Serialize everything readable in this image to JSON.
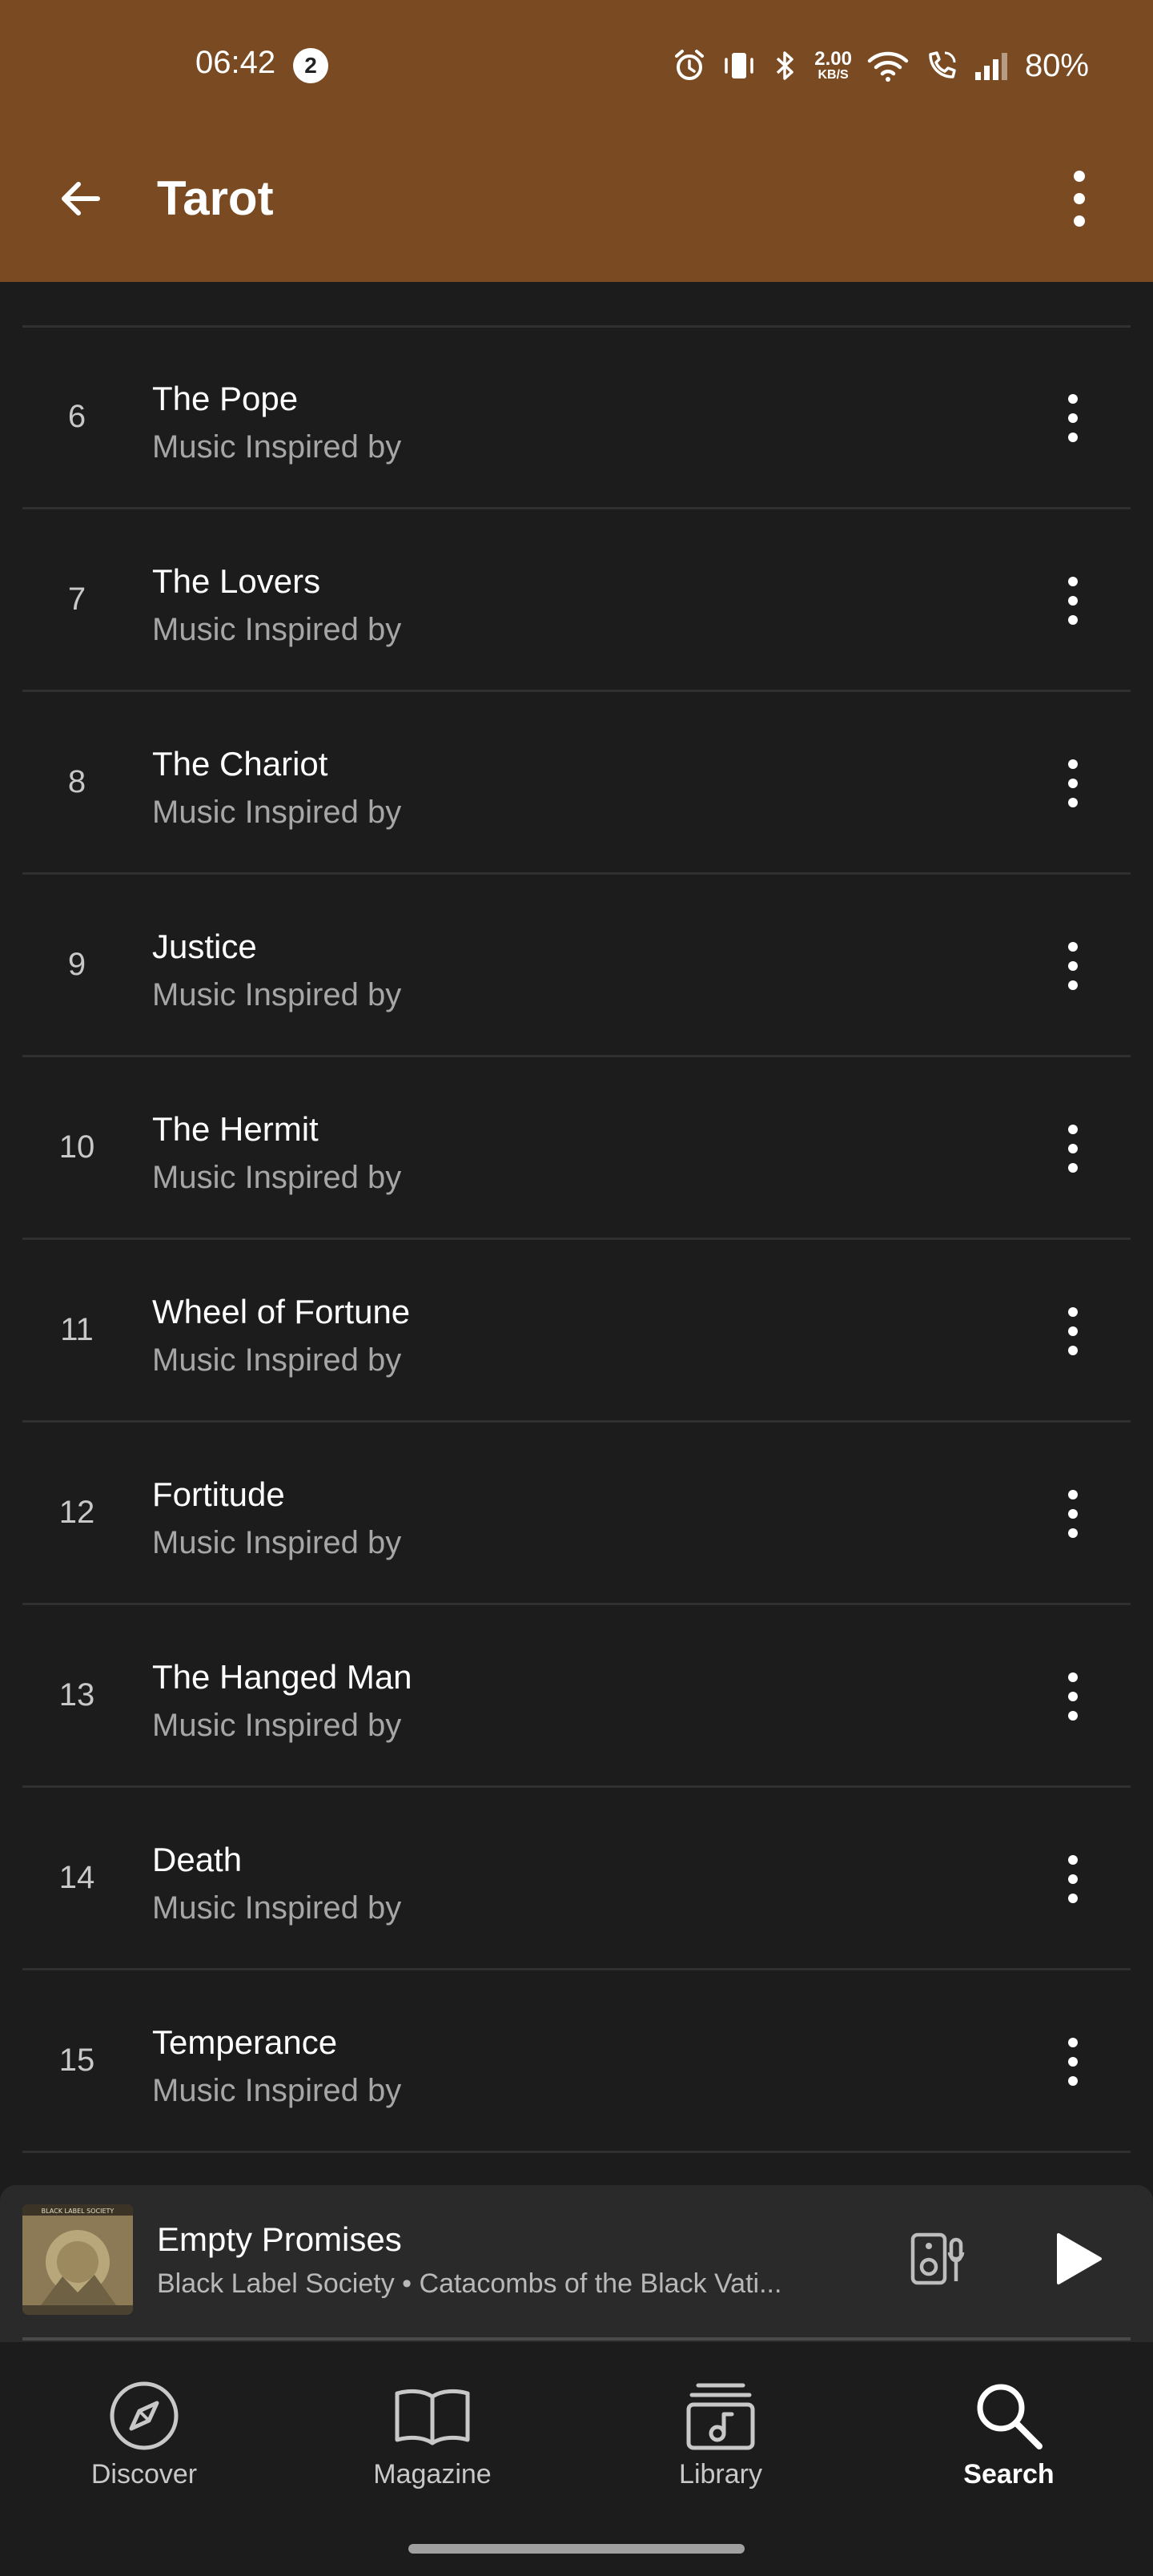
{
  "status_bar": {
    "time": "06:42",
    "notification_count": "2",
    "data_rate_value": "2.00",
    "data_rate_unit": "KB/S",
    "battery": "80%",
    "icons": [
      "alarm-icon",
      "vibrate-icon",
      "bluetooth-icon",
      "wifi-icon",
      "wifi-call-icon",
      "signal-icon"
    ]
  },
  "app_bar": {
    "title": "Tarot",
    "back_icon": "arrow-left-icon",
    "menu_icon": "more-vert-icon",
    "color": "#7a4b22"
  },
  "tracks": [
    {
      "number": "6",
      "title": "The Pope",
      "subtitle": "Music Inspired by"
    },
    {
      "number": "7",
      "title": "The Lovers",
      "subtitle": "Music Inspired by"
    },
    {
      "number": "8",
      "title": "The Chariot",
      "subtitle": "Music Inspired by"
    },
    {
      "number": "9",
      "title": "Justice",
      "subtitle": "Music Inspired by"
    },
    {
      "number": "10",
      "title": "The Hermit",
      "subtitle": "Music Inspired by"
    },
    {
      "number": "11",
      "title": "Wheel of Fortune",
      "subtitle": "Music Inspired by"
    },
    {
      "number": "12",
      "title": "Fortitude",
      "subtitle": "Music Inspired by"
    },
    {
      "number": "13",
      "title": "The Hanged Man",
      "subtitle": "Music Inspired by"
    },
    {
      "number": "14",
      "title": "Death",
      "subtitle": "Music Inspired by"
    },
    {
      "number": "15",
      "title": "Temperance",
      "subtitle": "Music Inspired by"
    }
  ],
  "mini_player": {
    "title": "Empty Promises",
    "subtitle": "Black Label Society • Catacombs of the Black Vati...",
    "album_art_text": "BLACK LABEL SOCIETY",
    "speaker_icon": "speaker-icon",
    "play_icon": "play-icon"
  },
  "bottom_nav": {
    "items": [
      {
        "label": "Discover",
        "icon": "compass-icon",
        "active": false
      },
      {
        "label": "Magazine",
        "icon": "book-icon",
        "active": false
      },
      {
        "label": "Library",
        "icon": "library-icon",
        "active": false
      },
      {
        "label": "Search",
        "icon": "search-icon",
        "active": true
      }
    ]
  }
}
